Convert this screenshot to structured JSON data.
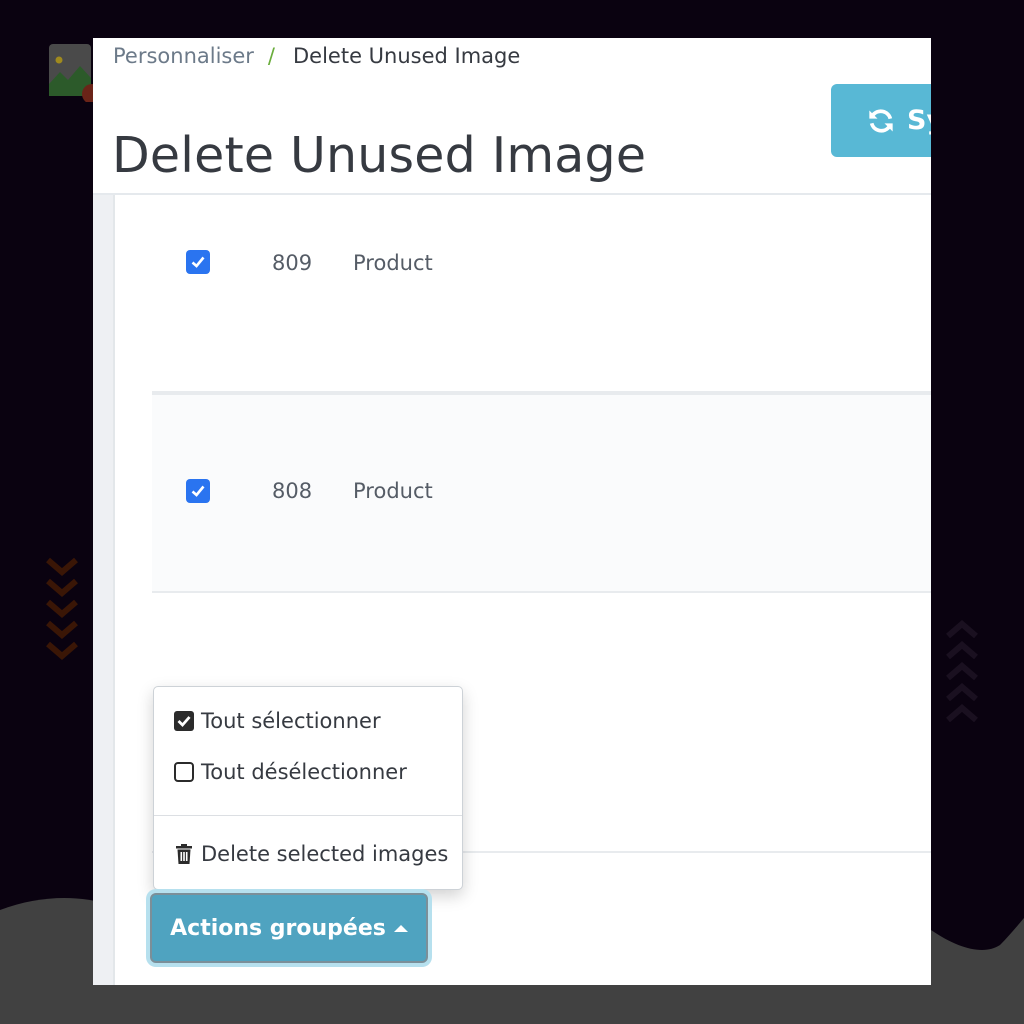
{
  "breadcrumb": {
    "parent": "Personnaliser",
    "separator": "/",
    "current": "Delete Unused Image"
  },
  "header": {
    "title": "Delete Unused Image",
    "sync_button_label": "Sy",
    "sync_icon": "refresh-icon"
  },
  "table": {
    "rows": [
      {
        "checked": true,
        "id": "809",
        "type": "Product"
      },
      {
        "checked": true,
        "id": "808",
        "type": "Product"
      }
    ]
  },
  "bulk_actions": {
    "button_label": "Actions groupées",
    "menu": [
      {
        "icon": "checked-square-icon",
        "label": "Tout sélectionner"
      },
      {
        "icon": "empty-square-icon",
        "label": "Tout désélectionner"
      },
      {
        "icon": "trash-icon",
        "label": "Delete selected images"
      }
    ]
  },
  "colors": {
    "accent": "#58b8d5",
    "checkbox": "#2a74f0",
    "actions_button": "#4fa3c0",
    "breadcrumb_separator": "#6aad3d"
  }
}
